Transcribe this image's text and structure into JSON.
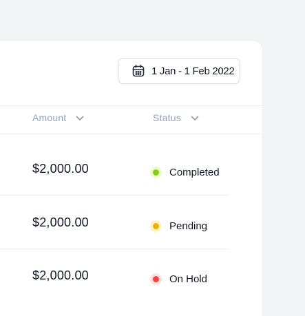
{
  "header": {
    "date_range_label": "1 Jan - 1 Feb 2022",
    "date_icon": "calendar-icon"
  },
  "table": {
    "columns": [
      {
        "label": "Amount",
        "sort_icon": "chevron-down-icon"
      },
      {
        "label": "Status",
        "sort_icon": "chevron-down-icon"
      }
    ],
    "rows": [
      {
        "amount": "$2,000.00",
        "status": "Completed",
        "status_color": "#84cc16",
        "status_halo": "#ecfccb"
      },
      {
        "amount": "$2,000.00",
        "status": "Pending",
        "status_color": "#eab308",
        "status_halo": "#fef3c7"
      },
      {
        "amount": "$2,000.00",
        "status": "On Hold",
        "status_color": "#ef4444",
        "status_halo": "#fee2e2"
      }
    ]
  }
}
